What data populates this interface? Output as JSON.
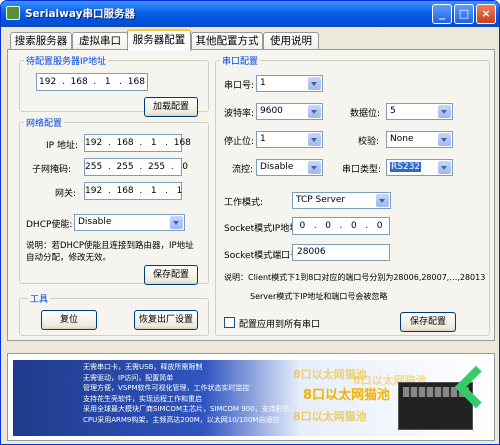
{
  "window": {
    "title": "Serialway串口服务器",
    "min": "_",
    "max": "□",
    "close": "×"
  },
  "tabs": [
    "搜索服务器",
    "虚拟串口",
    "服务器配置",
    "其他配置方式",
    "使用说明"
  ],
  "pending": {
    "legend": "待配置服务器IP地址",
    "ip": "192  .  168  .   1   .  168",
    "load_button": "加载配置"
  },
  "network": {
    "legend": "网络配置",
    "ip_label": "IP 地址:",
    "ip": "192  .  168  .   1   .  168",
    "mask_label": "子网掩码:",
    "mask": "255  .  255  .  255  .   0",
    "gw_label": "网关:",
    "gw": "192  .  168  .   1   .   1",
    "dhcp_label": "DHCP使能:",
    "dhcp": "Disable",
    "note": "说明：若DHCP使能且连接到路由器，IP地址自动分配，修改无效。",
    "save_button": "保存配置"
  },
  "tools": {
    "legend": "工具",
    "reset_button": "复位",
    "factory_button": "恢复出厂设置"
  },
  "serial": {
    "legend": "串口配置",
    "port_label": "串口号:",
    "port": "1",
    "baud_label": "波特率:",
    "baud": "9600",
    "data_label": "数据位:",
    "data": "5",
    "stop_label": "停止位:",
    "stop": "1",
    "parity_label": "校验:",
    "parity": "None",
    "flow_label": "流控:",
    "flow": "Disable",
    "type_label": "串口类型:",
    "type": "RS232",
    "mode_label": "工作模式:",
    "mode": "TCP Server",
    "socket_ip_label": "Socket模式IP地址:",
    "socket_ip": "0   .   0   .   0   .   0",
    "socket_port_label": "Socket模式端口号:",
    "socket_port": "28006",
    "note1": "说明：Client模式下1到8口对应的端口号分别为28006,28007,…,28013",
    "note2": "Server模式下IP地址和端口号会被忽略",
    "apply_all": "配置应用到所有串口",
    "save_button": "保存配置"
  },
  "banner": {
    "features": [
      "无需串口卡，无需USB，释放所需限制",
      "无需驱动，IP访问，配置简单",
      "管理方便，VSPM软件可视化管理，工作状态实时监控",
      "支持花生壳软件，实现远程工作和重启",
      "采用全球最大模块厂商SIMCOM主芯片，SIMCOM 900，支持彩信。",
      "CPU采用ARM9构架，主频高达200M，以太网10/100M自适应"
    ],
    "slogans": [
      "8口以太网猫池",
      "8口以太网猫池",
      "8口以太网猫池",
      "8口以太网猫池"
    ]
  }
}
